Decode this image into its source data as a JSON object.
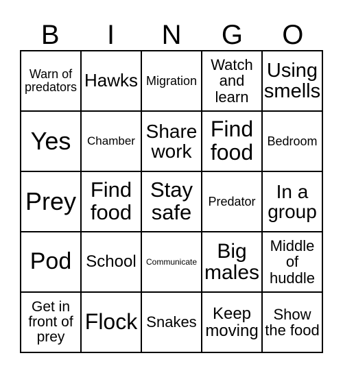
{
  "header": [
    "B",
    "I",
    "N",
    "G",
    "O"
  ],
  "cells": [
    "Warn of predators",
    "Hawks",
    "Migration",
    "Watch and learn",
    "Using smells",
    "Yes",
    "Chamber",
    "Share work",
    "Find food",
    "Bedroom",
    "Prey",
    "Find food",
    "Stay safe",
    "Predator",
    "In a group",
    "Pod",
    "School",
    "Communicate",
    "Big males",
    "Middle of huddle",
    "Get in front of prey",
    "Flock",
    "Snakes",
    "Keep moving",
    "Show the food"
  ]
}
